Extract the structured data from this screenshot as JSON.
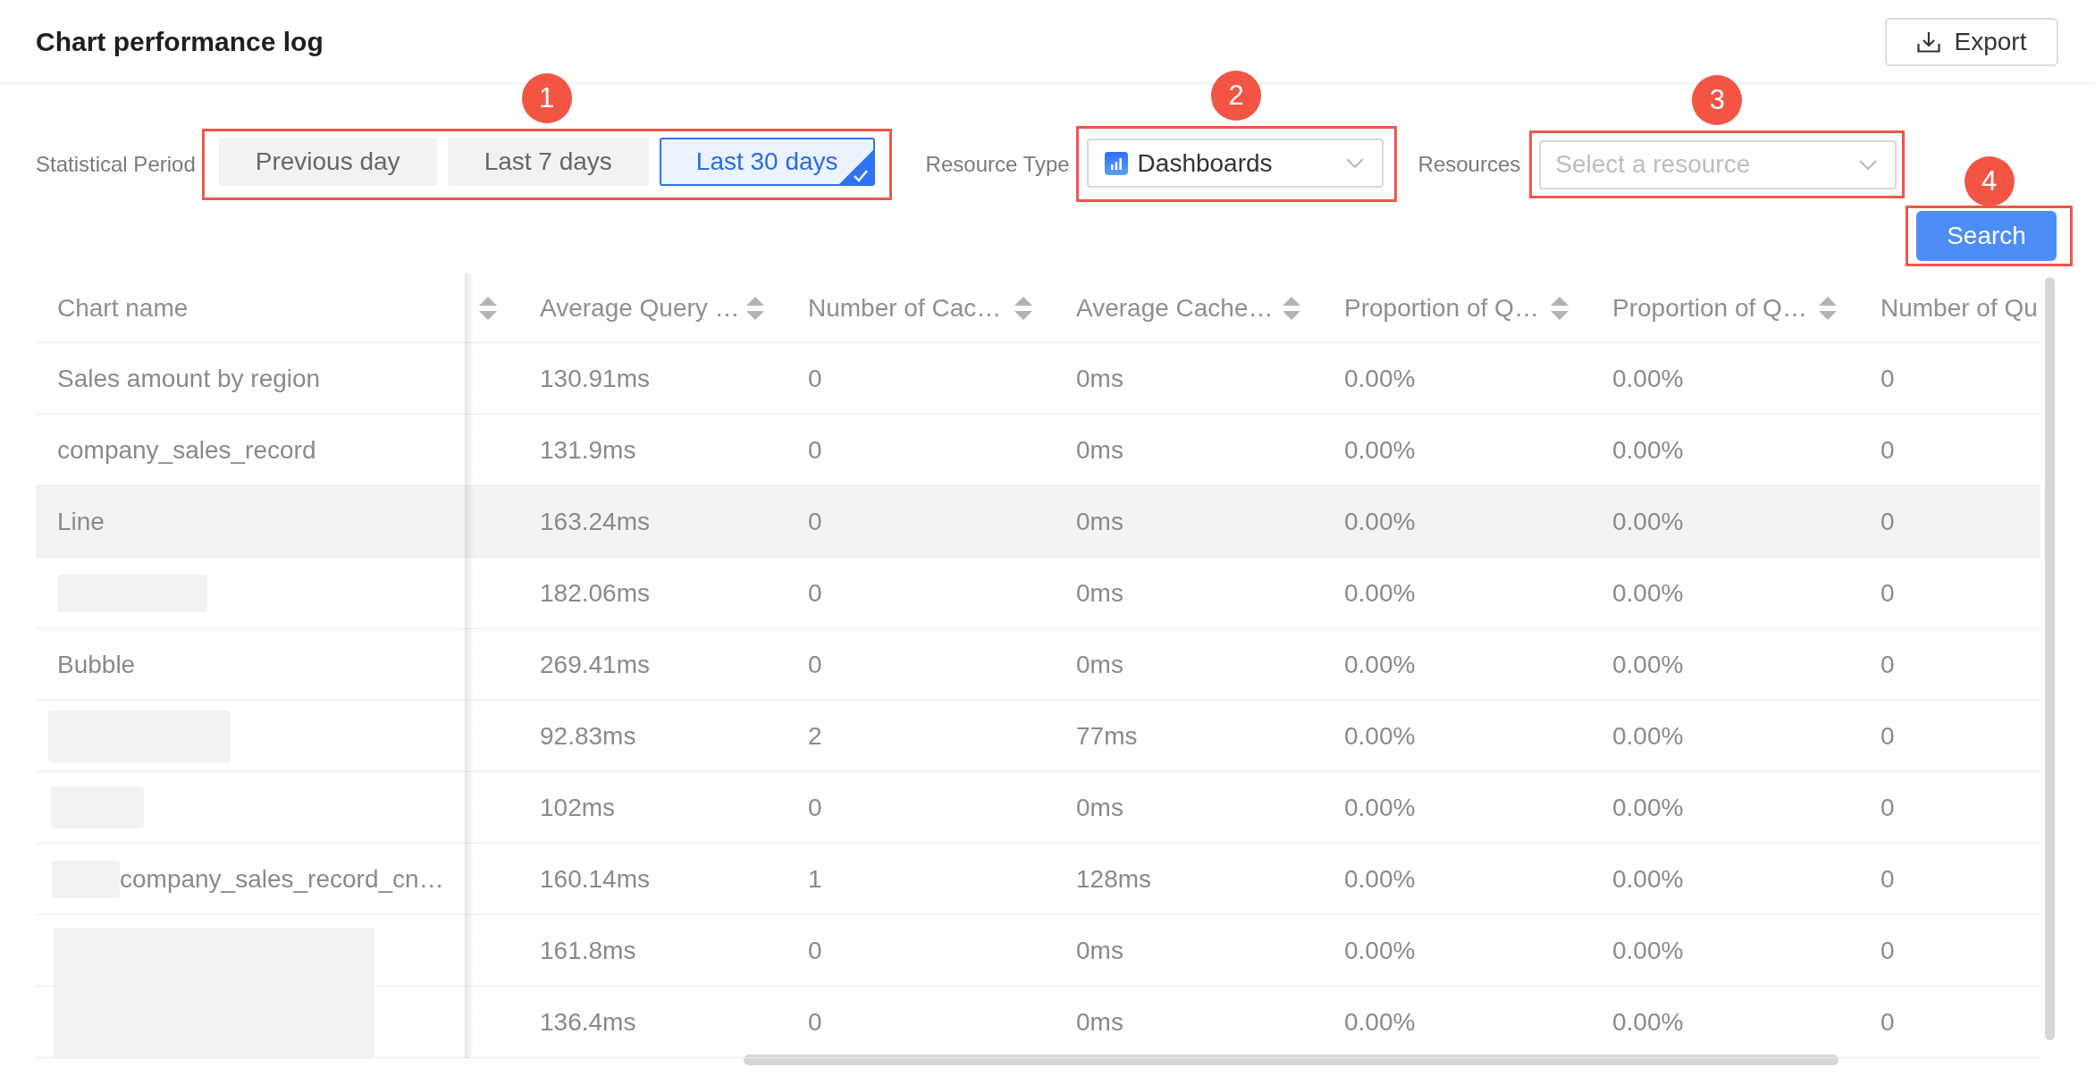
{
  "header": {
    "title": "Chart performance log",
    "export_button": {
      "label": "Export"
    }
  },
  "filters": {
    "statistical_period": {
      "label": "Statistical Period",
      "callout": "1",
      "options": [
        {
          "label": "Previous day",
          "selected": false
        },
        {
          "label": "Last 7 days",
          "selected": false
        },
        {
          "label": "Last 30 days",
          "selected": true
        }
      ]
    },
    "resource_type": {
      "label": "Resource Type",
      "callout": "2",
      "value": "Dashboards"
    },
    "resources": {
      "label": "Resources",
      "callout": "3",
      "placeholder": "Select a resource"
    },
    "search_button": {
      "label": "Search",
      "callout": "4"
    }
  },
  "table": {
    "columns": [
      {
        "kind": "pinned",
        "label": "Chart name"
      },
      {
        "kind": "scrolled_off",
        "sortable": true
      },
      {
        "kind": "data",
        "label": "Average Query …",
        "sortable": true
      },
      {
        "kind": "data",
        "label": "Number of Cac…",
        "sortable": true
      },
      {
        "kind": "data",
        "label": "Average Cache…",
        "sortable": true
      },
      {
        "kind": "data",
        "label": "Proportion of Q…",
        "sortable": true
      },
      {
        "kind": "data",
        "label": "Proportion of Q…",
        "sortable": true
      },
      {
        "kind": "cut_off",
        "label": "Number of Qu"
      }
    ],
    "rows": [
      {
        "kind": "text",
        "highlighted": false,
        "cells": [
          "Sales amount by region",
          "",
          "130.91ms",
          "0",
          "0ms",
          "0.00%",
          "0.00%",
          "0"
        ]
      },
      {
        "kind": "text",
        "highlighted": false,
        "cells": [
          "company_sales_record",
          "",
          "131.9ms",
          "0",
          "0ms",
          "0.00%",
          "0.00%",
          "0"
        ]
      },
      {
        "kind": "text",
        "highlighted": true,
        "cells": [
          "Line",
          "",
          "163.24ms",
          "0",
          "0ms",
          "0.00%",
          "0.00%",
          "0"
        ]
      },
      {
        "kind": "blur",
        "highlighted": false,
        "cells": [
          "",
          "",
          "182.06ms",
          "0",
          "0ms",
          "0.00%",
          "0.00%",
          "0"
        ]
      },
      {
        "kind": "text",
        "highlighted": false,
        "cells": [
          "Bubble",
          "",
          "269.41ms",
          "0",
          "0ms",
          "0.00%",
          "0.00%",
          "0"
        ]
      },
      {
        "kind": "blurwide",
        "highlighted": false,
        "cells": [
          "",
          "",
          "92.83ms",
          "2",
          "77ms",
          "0.00%",
          "0.00%",
          "0"
        ]
      },
      {
        "kind": "blurshort",
        "highlighted": false,
        "cells": [
          "",
          "",
          "102ms",
          "0",
          "0ms",
          "0.00%",
          "0.00%",
          "0"
        ]
      },
      {
        "kind": "blurprefix",
        "highlighted": false,
        "cells": [
          "company_sales_record_cn…",
          "",
          "160.14ms",
          "1",
          "128ms",
          "0.00%",
          "0.00%",
          "0"
        ]
      },
      {
        "kind": "blurtall",
        "highlighted": false,
        "cells": [
          "",
          "",
          "161.8ms",
          "0",
          "0ms",
          "0.00%",
          "0.00%",
          "0"
        ]
      },
      {
        "kind": "text",
        "highlighted": false,
        "cells": [
          "",
          "",
          "136.4ms",
          "0",
          "0ms",
          "0.00%",
          "0.00%",
          "0"
        ]
      }
    ]
  }
}
